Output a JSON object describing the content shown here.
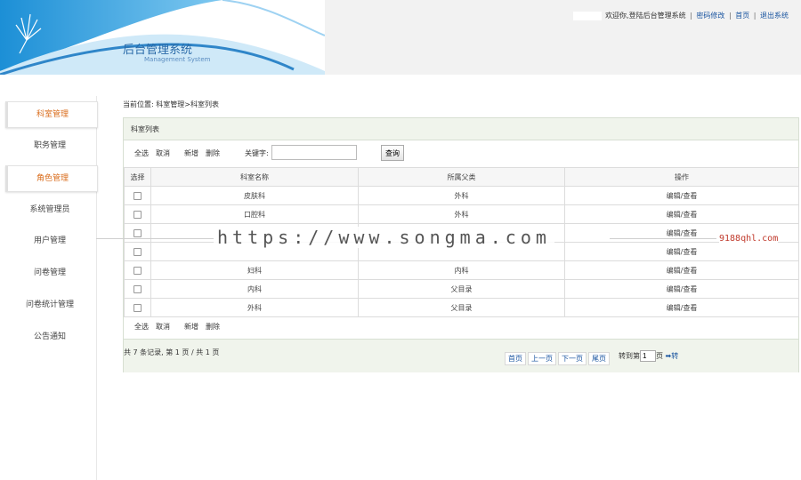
{
  "header": {
    "brand_title": "后台管理系统",
    "brand_subtitle": "Management System",
    "welcome_text": "欢迎你,登陆后台管理系统",
    "links": [
      "密码修改",
      "首页",
      "退出系统"
    ],
    "separator": "|"
  },
  "sidebar": {
    "items": [
      {
        "label": "科室管理",
        "active": true
      },
      {
        "label": "职务管理",
        "active": false
      },
      {
        "label": "角色管理",
        "active": true
      },
      {
        "label": "系统管理员",
        "active": false
      },
      {
        "label": "用户管理",
        "active": false
      },
      {
        "label": "问卷管理",
        "active": false
      },
      {
        "label": "问卷统计管理",
        "active": false
      },
      {
        "label": "公告通知",
        "active": false
      }
    ]
  },
  "breadcrumb": "当前位置: 科室管理>科室列表",
  "panel": {
    "title": "科室列表",
    "toolbar": [
      "全选",
      "取消",
      "新增",
      "删除"
    ],
    "keyword_label": "关键字:",
    "keyword_value": "",
    "search_label": "查询"
  },
  "table": {
    "headers": [
      "选择",
      "科室名称",
      "所属父类",
      "操作"
    ],
    "rows": [
      {
        "name": "皮肤科",
        "parent": "外科",
        "action": "编辑/查看"
      },
      {
        "name": "口腔科",
        "parent": "外科",
        "action": "编辑/查看"
      },
      {
        "name": "",
        "parent": "",
        "action": "编辑/查看"
      },
      {
        "name": "",
        "parent": "",
        "action": "编辑/查看"
      },
      {
        "name": "妇科",
        "parent": "内科",
        "action": "编辑/查看"
      },
      {
        "name": "内科",
        "parent": "父目录",
        "action": "编辑/查看"
      },
      {
        "name": "外科",
        "parent": "父目录",
        "action": "编辑/查看"
      }
    ]
  },
  "pager": {
    "info": "共 7 条记录, 第 1 页 / 共 1 页",
    "links": [
      "首页",
      "上一页",
      "下一页",
      "尾页"
    ],
    "jump_label": "转到第",
    "jump_value": "1",
    "jump_unit": "页",
    "go_label": "➡转"
  },
  "watermark": {
    "main": "https://www.songma.com",
    "side": "9188qhl.com"
  }
}
